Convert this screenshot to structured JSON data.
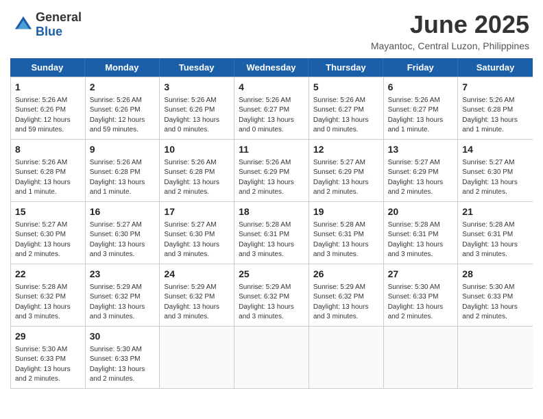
{
  "header": {
    "logo_general": "General",
    "logo_blue": "Blue",
    "month_title": "June 2025",
    "location": "Mayantoc, Central Luzon, Philippines"
  },
  "calendar": {
    "headers": [
      "Sunday",
      "Monday",
      "Tuesday",
      "Wednesday",
      "Thursday",
      "Friday",
      "Saturday"
    ],
    "weeks": [
      [
        {
          "day": "",
          "info": ""
        },
        {
          "day": "2",
          "info": "Sunrise: 5:26 AM\nSunset: 6:26 PM\nDaylight: 12 hours\nand 59 minutes."
        },
        {
          "day": "3",
          "info": "Sunrise: 5:26 AM\nSunset: 6:26 PM\nDaylight: 13 hours\nand 0 minutes."
        },
        {
          "day": "4",
          "info": "Sunrise: 5:26 AM\nSunset: 6:27 PM\nDaylight: 13 hours\nand 0 minutes."
        },
        {
          "day": "5",
          "info": "Sunrise: 5:26 AM\nSunset: 6:27 PM\nDaylight: 13 hours\nand 0 minutes."
        },
        {
          "day": "6",
          "info": "Sunrise: 5:26 AM\nSunset: 6:27 PM\nDaylight: 13 hours\nand 1 minute."
        },
        {
          "day": "7",
          "info": "Sunrise: 5:26 AM\nSunset: 6:28 PM\nDaylight: 13 hours\nand 1 minute."
        }
      ],
      [
        {
          "day": "1",
          "info": "Sunrise: 5:26 AM\nSunset: 6:26 PM\nDaylight: 12 hours\nand 59 minutes.",
          "first": true
        },
        {
          "day": "8",
          "info": "Sunrise: 5:26 AM\nSunset: 6:28 PM\nDaylight: 13 hours\nand 1 minute."
        },
        {
          "day": "9",
          "info": "Sunrise: 5:26 AM\nSunset: 6:28 PM\nDaylight: 13 hours\nand 1 minute."
        },
        {
          "day": "10",
          "info": "Sunrise: 5:26 AM\nSunset: 6:28 PM\nDaylight: 13 hours\nand 2 minutes."
        },
        {
          "day": "11",
          "info": "Sunrise: 5:26 AM\nSunset: 6:29 PM\nDaylight: 13 hours\nand 2 minutes."
        },
        {
          "day": "12",
          "info": "Sunrise: 5:27 AM\nSunset: 6:29 PM\nDaylight: 13 hours\nand 2 minutes."
        },
        {
          "day": "13",
          "info": "Sunrise: 5:27 AM\nSunset: 6:29 PM\nDaylight: 13 hours\nand 2 minutes."
        }
      ],
      [
        {
          "day": "14",
          "info": "Sunrise: 5:27 AM\nSunset: 6:30 PM\nDaylight: 13 hours\nand 2 minutes."
        },
        {
          "day": "15",
          "info": "Sunrise: 5:27 AM\nSunset: 6:30 PM\nDaylight: 13 hours\nand 2 minutes."
        },
        {
          "day": "16",
          "info": "Sunrise: 5:27 AM\nSunset: 6:30 PM\nDaylight: 13 hours\nand 3 minutes."
        },
        {
          "day": "17",
          "info": "Sunrise: 5:27 AM\nSunset: 6:30 PM\nDaylight: 13 hours\nand 3 minutes."
        },
        {
          "day": "18",
          "info": "Sunrise: 5:28 AM\nSunset: 6:31 PM\nDaylight: 13 hours\nand 3 minutes."
        },
        {
          "day": "19",
          "info": "Sunrise: 5:28 AM\nSunset: 6:31 PM\nDaylight: 13 hours\nand 3 minutes."
        },
        {
          "day": "20",
          "info": "Sunrise: 5:28 AM\nSunset: 6:31 PM\nDaylight: 13 hours\nand 3 minutes."
        }
      ],
      [
        {
          "day": "21",
          "info": "Sunrise: 5:28 AM\nSunset: 6:31 PM\nDaylight: 13 hours\nand 3 minutes."
        },
        {
          "day": "22",
          "info": "Sunrise: 5:28 AM\nSunset: 6:32 PM\nDaylight: 13 hours\nand 3 minutes."
        },
        {
          "day": "23",
          "info": "Sunrise: 5:29 AM\nSunset: 6:32 PM\nDaylight: 13 hours\nand 3 minutes."
        },
        {
          "day": "24",
          "info": "Sunrise: 5:29 AM\nSunset: 6:32 PM\nDaylight: 13 hours\nand 3 minutes."
        },
        {
          "day": "25",
          "info": "Sunrise: 5:29 AM\nSunset: 6:32 PM\nDaylight: 13 hours\nand 3 minutes."
        },
        {
          "day": "26",
          "info": "Sunrise: 5:29 AM\nSunset: 6:32 PM\nDaylight: 13 hours\nand 3 minutes."
        },
        {
          "day": "27",
          "info": "Sunrise: 5:30 AM\nSunset: 6:33 PM\nDaylight: 13 hours\nand 2 minutes."
        }
      ],
      [
        {
          "day": "28",
          "info": "Sunrise: 5:30 AM\nSunset: 6:33 PM\nDaylight: 13 hours\nand 2 minutes."
        },
        {
          "day": "29",
          "info": "Sunrise: 5:30 AM\nSunset: 6:33 PM\nDaylight: 13 hours\nand 2 minutes."
        },
        {
          "day": "30",
          "info": "Sunrise: 5:30 AM\nSunset: 6:33 PM\nDaylight: 13 hours\nand 2 minutes."
        },
        {
          "day": "",
          "info": ""
        },
        {
          "day": "",
          "info": ""
        },
        {
          "day": "",
          "info": ""
        },
        {
          "day": "",
          "info": ""
        }
      ]
    ]
  }
}
